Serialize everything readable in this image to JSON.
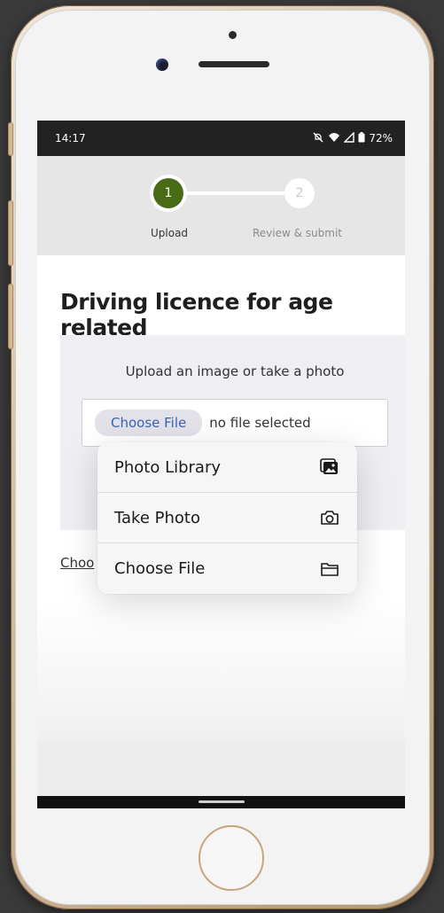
{
  "status_bar": {
    "time": "14:17",
    "battery": "72%"
  },
  "stepper": {
    "steps": [
      {
        "number": "1",
        "label": "Upload",
        "state": "active"
      },
      {
        "number": "2",
        "label": "Review & submit",
        "state": "inactive"
      }
    ]
  },
  "page": {
    "title": "Driving licence for age related",
    "upload_hint": "Upload an image or take a photo",
    "file_input": {
      "button_label": "Choose File",
      "status": "no file selected"
    },
    "behind_link": "Choo"
  },
  "file_picker_menu": {
    "items": [
      {
        "label": "Photo Library",
        "icon": "photo-library-icon"
      },
      {
        "label": "Take Photo",
        "icon": "camera-icon"
      },
      {
        "label": "Choose File",
        "icon": "folder-icon"
      }
    ]
  },
  "colors": {
    "step_active": "#4a6b16",
    "link_blue": "#3b62b8",
    "status_bar_bg": "#222222"
  }
}
